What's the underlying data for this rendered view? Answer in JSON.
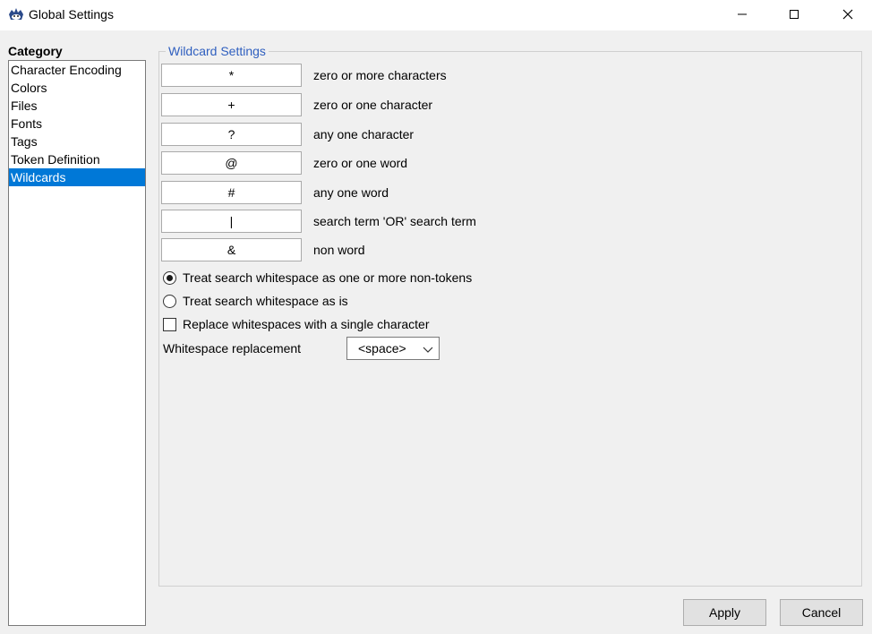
{
  "window": {
    "title": "Global Settings"
  },
  "category": {
    "label": "Category",
    "items": [
      {
        "label": "Character Encoding",
        "selected": false
      },
      {
        "label": "Colors",
        "selected": false
      },
      {
        "label": "Files",
        "selected": false
      },
      {
        "label": "Fonts",
        "selected": false
      },
      {
        "label": "Tags",
        "selected": false
      },
      {
        "label": "Token Definition",
        "selected": false
      },
      {
        "label": "Wildcards",
        "selected": true
      }
    ]
  },
  "wildcards": {
    "legend": "Wildcard Settings",
    "rows": [
      {
        "symbol": "*",
        "description": "zero or more characters"
      },
      {
        "symbol": "+",
        "description": "zero or one character"
      },
      {
        "symbol": "?",
        "description": "any one character"
      },
      {
        "symbol": "@",
        "description": "zero or one word"
      },
      {
        "symbol": "#",
        "description": "any one word"
      },
      {
        "symbol": "|",
        "description": "search term 'OR' search term"
      },
      {
        "symbol": "&",
        "description": "non word"
      }
    ],
    "radio_one_or_more": "Treat search whitespace as one or more non-tokens",
    "radio_as_is": "Treat search whitespace as is",
    "replace_checkbox": "Replace whitespaces with a single character",
    "whitespace_label": "Whitespace replacement",
    "whitespace_value": "<space>",
    "radio_selected": "one_or_more",
    "replace_checked": false
  },
  "buttons": {
    "apply": "Apply",
    "cancel": "Cancel"
  },
  "colors": {
    "selection": "#0078d7",
    "legend": "#2f5fbf"
  }
}
